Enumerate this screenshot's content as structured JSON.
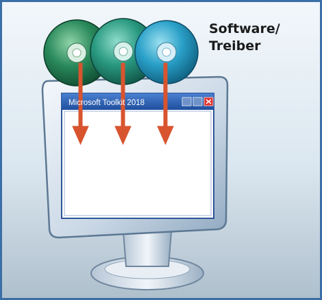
{
  "caption": {
    "line1": "Software/",
    "line2": "Treiber"
  },
  "window": {
    "title": "Microsoft Toolkit 2018",
    "controls": [
      "minimize-icon",
      "maximize-icon",
      "close-icon"
    ]
  },
  "discs": [
    {
      "color": "#1f7a52"
    },
    {
      "color": "#1f8a6e"
    },
    {
      "color": "#1f8fb3"
    }
  ],
  "colors": {
    "background_top": "#e9f2f8",
    "background_bottom": "#b7c9d6",
    "frame_border": "#3b6ea6",
    "arrow": "#d8542f",
    "title_bar": "#2e61b5",
    "close_button": "#e0302a"
  }
}
